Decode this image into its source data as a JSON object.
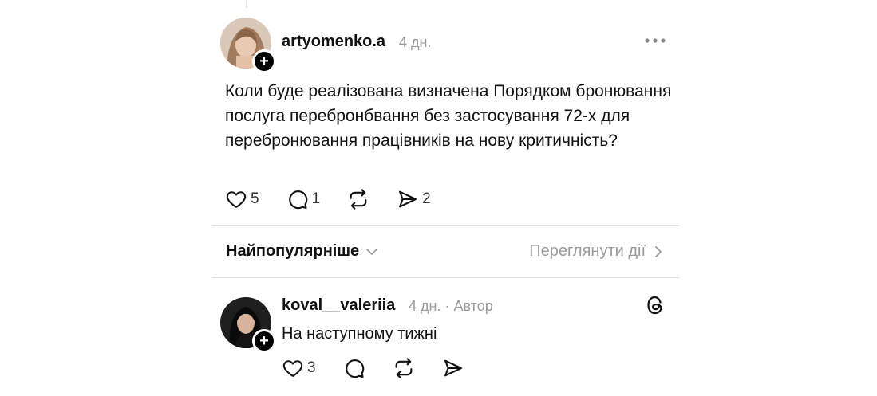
{
  "post": {
    "username": "artyomenko.a",
    "time": "4 дн.",
    "text": "Коли буде реалізована визначена Порядком бронювання послуга перебронбвання без застосування 72-х для перебронювання працівників на нову критичність?",
    "likes": "5",
    "replies": "1",
    "shares": "2"
  },
  "sort": {
    "label": "Найпопулярніше",
    "view_activity": "Переглянути дії"
  },
  "reply": {
    "username": "koval__valeriia",
    "time": "4 дн.",
    "separator": "·",
    "author_tag": "Автор",
    "text": "На наступному тижні",
    "likes": "3"
  },
  "icons": {
    "plus": "+",
    "more": "more-dots-icon",
    "like": "heart-icon",
    "reply": "comment-icon",
    "repost": "repost-icon",
    "share": "send-icon",
    "threads": "threads-logo-icon",
    "chevron_down": "chevron-down-icon",
    "chevron_right": "chevron-right-icon"
  }
}
